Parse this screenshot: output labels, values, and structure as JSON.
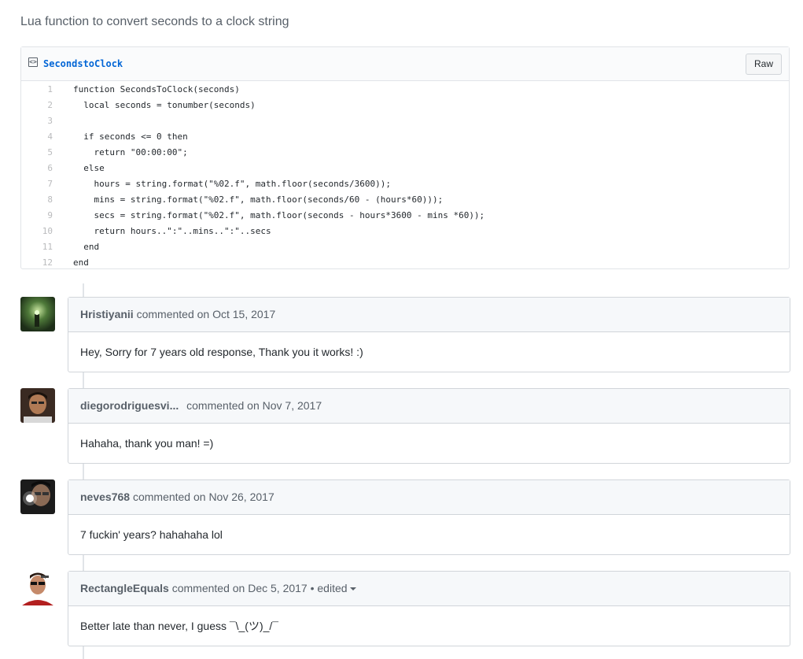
{
  "gist": {
    "description": "Lua function to convert seconds to a clock string",
    "file_name": "SecondstoClock",
    "raw_label": "Raw",
    "code_icon": "file-code-icon"
  },
  "code": [
    {
      "n": "1",
      "text": "function SecondsToClock(seconds)"
    },
    {
      "n": "2",
      "text": "  local seconds = tonumber(seconds)"
    },
    {
      "n": "3",
      "text": ""
    },
    {
      "n": "4",
      "text": "  if seconds <= 0 then"
    },
    {
      "n": "5",
      "text": "    return \"00:00:00\";"
    },
    {
      "n": "6",
      "text": "  else"
    },
    {
      "n": "7",
      "text": "    hours = string.format(\"%02.f\", math.floor(seconds/3600));"
    },
    {
      "n": "8",
      "text": "    mins = string.format(\"%02.f\", math.floor(seconds/60 - (hours*60)));"
    },
    {
      "n": "9",
      "text": "    secs = string.format(\"%02.f\", math.floor(seconds - hours*3600 - mins *60));"
    },
    {
      "n": "10",
      "text": "    return hours..\":\"..mins..\":\"..secs"
    },
    {
      "n": "11",
      "text": "  end"
    },
    {
      "n": "12",
      "text": "end"
    }
  ],
  "comments": [
    {
      "author": "Hristiyanii",
      "meta": " commented on Oct 15, 2017",
      "edited": "",
      "body": "Hey, Sorry for 7 years old response, Thank you it works! :)"
    },
    {
      "author": "diegorodriguesvi...",
      "meta": " commented on Nov 7, 2017",
      "edited": "",
      "body": "Hahaha, thank you man! =)"
    },
    {
      "author": "neves768",
      "meta": " commented on Nov 26, 2017",
      "edited": "",
      "body": "7 fuckin' years? hahahaha lol"
    },
    {
      "author": "RectangleEquals",
      "meta": " commented on Dec 5, 2017",
      "edited": " • edited",
      "body": "Better late than never, I guess ¯\\_(ツ)_/¯"
    }
  ],
  "colors": {
    "link": "#0366d6",
    "border": "#d1d5da",
    "header_bg": "#f6f8fa"
  }
}
